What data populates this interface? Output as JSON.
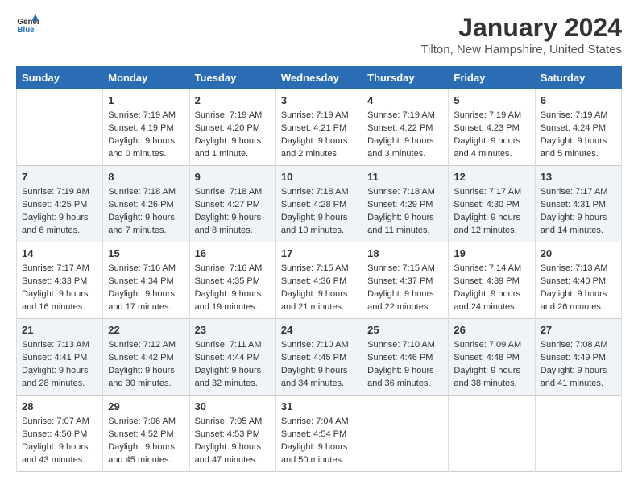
{
  "header": {
    "logo_line1": "General",
    "logo_line2": "Blue",
    "month_title": "January 2024",
    "location": "Tilton, New Hampshire, United States"
  },
  "days_of_week": [
    "Sunday",
    "Monday",
    "Tuesday",
    "Wednesday",
    "Thursday",
    "Friday",
    "Saturday"
  ],
  "weeks": [
    [
      {
        "num": "",
        "sunrise": "",
        "sunset": "",
        "daylight": ""
      },
      {
        "num": "1",
        "sunrise": "Sunrise: 7:19 AM",
        "sunset": "Sunset: 4:19 PM",
        "daylight": "Daylight: 9 hours and 0 minutes."
      },
      {
        "num": "2",
        "sunrise": "Sunrise: 7:19 AM",
        "sunset": "Sunset: 4:20 PM",
        "daylight": "Daylight: 9 hours and 1 minute."
      },
      {
        "num": "3",
        "sunrise": "Sunrise: 7:19 AM",
        "sunset": "Sunset: 4:21 PM",
        "daylight": "Daylight: 9 hours and 2 minutes."
      },
      {
        "num": "4",
        "sunrise": "Sunrise: 7:19 AM",
        "sunset": "Sunset: 4:22 PM",
        "daylight": "Daylight: 9 hours and 3 minutes."
      },
      {
        "num": "5",
        "sunrise": "Sunrise: 7:19 AM",
        "sunset": "Sunset: 4:23 PM",
        "daylight": "Daylight: 9 hours and 4 minutes."
      },
      {
        "num": "6",
        "sunrise": "Sunrise: 7:19 AM",
        "sunset": "Sunset: 4:24 PM",
        "daylight": "Daylight: 9 hours and 5 minutes."
      }
    ],
    [
      {
        "num": "7",
        "sunrise": "Sunrise: 7:19 AM",
        "sunset": "Sunset: 4:25 PM",
        "daylight": "Daylight: 9 hours and 6 minutes."
      },
      {
        "num": "8",
        "sunrise": "Sunrise: 7:18 AM",
        "sunset": "Sunset: 4:26 PM",
        "daylight": "Daylight: 9 hours and 7 minutes."
      },
      {
        "num": "9",
        "sunrise": "Sunrise: 7:18 AM",
        "sunset": "Sunset: 4:27 PM",
        "daylight": "Daylight: 9 hours and 8 minutes."
      },
      {
        "num": "10",
        "sunrise": "Sunrise: 7:18 AM",
        "sunset": "Sunset: 4:28 PM",
        "daylight": "Daylight: 9 hours and 10 minutes."
      },
      {
        "num": "11",
        "sunrise": "Sunrise: 7:18 AM",
        "sunset": "Sunset: 4:29 PM",
        "daylight": "Daylight: 9 hours and 11 minutes."
      },
      {
        "num": "12",
        "sunrise": "Sunrise: 7:17 AM",
        "sunset": "Sunset: 4:30 PM",
        "daylight": "Daylight: 9 hours and 12 minutes."
      },
      {
        "num": "13",
        "sunrise": "Sunrise: 7:17 AM",
        "sunset": "Sunset: 4:31 PM",
        "daylight": "Daylight: 9 hours and 14 minutes."
      }
    ],
    [
      {
        "num": "14",
        "sunrise": "Sunrise: 7:17 AM",
        "sunset": "Sunset: 4:33 PM",
        "daylight": "Daylight: 9 hours and 16 minutes."
      },
      {
        "num": "15",
        "sunrise": "Sunrise: 7:16 AM",
        "sunset": "Sunset: 4:34 PM",
        "daylight": "Daylight: 9 hours and 17 minutes."
      },
      {
        "num": "16",
        "sunrise": "Sunrise: 7:16 AM",
        "sunset": "Sunset: 4:35 PM",
        "daylight": "Daylight: 9 hours and 19 minutes."
      },
      {
        "num": "17",
        "sunrise": "Sunrise: 7:15 AM",
        "sunset": "Sunset: 4:36 PM",
        "daylight": "Daylight: 9 hours and 21 minutes."
      },
      {
        "num": "18",
        "sunrise": "Sunrise: 7:15 AM",
        "sunset": "Sunset: 4:37 PM",
        "daylight": "Daylight: 9 hours and 22 minutes."
      },
      {
        "num": "19",
        "sunrise": "Sunrise: 7:14 AM",
        "sunset": "Sunset: 4:39 PM",
        "daylight": "Daylight: 9 hours and 24 minutes."
      },
      {
        "num": "20",
        "sunrise": "Sunrise: 7:13 AM",
        "sunset": "Sunset: 4:40 PM",
        "daylight": "Daylight: 9 hours and 26 minutes."
      }
    ],
    [
      {
        "num": "21",
        "sunrise": "Sunrise: 7:13 AM",
        "sunset": "Sunset: 4:41 PM",
        "daylight": "Daylight: 9 hours and 28 minutes."
      },
      {
        "num": "22",
        "sunrise": "Sunrise: 7:12 AM",
        "sunset": "Sunset: 4:42 PM",
        "daylight": "Daylight: 9 hours and 30 minutes."
      },
      {
        "num": "23",
        "sunrise": "Sunrise: 7:11 AM",
        "sunset": "Sunset: 4:44 PM",
        "daylight": "Daylight: 9 hours and 32 minutes."
      },
      {
        "num": "24",
        "sunrise": "Sunrise: 7:10 AM",
        "sunset": "Sunset: 4:45 PM",
        "daylight": "Daylight: 9 hours and 34 minutes."
      },
      {
        "num": "25",
        "sunrise": "Sunrise: 7:10 AM",
        "sunset": "Sunset: 4:46 PM",
        "daylight": "Daylight: 9 hours and 36 minutes."
      },
      {
        "num": "26",
        "sunrise": "Sunrise: 7:09 AM",
        "sunset": "Sunset: 4:48 PM",
        "daylight": "Daylight: 9 hours and 38 minutes."
      },
      {
        "num": "27",
        "sunrise": "Sunrise: 7:08 AM",
        "sunset": "Sunset: 4:49 PM",
        "daylight": "Daylight: 9 hours and 41 minutes."
      }
    ],
    [
      {
        "num": "28",
        "sunrise": "Sunrise: 7:07 AM",
        "sunset": "Sunset: 4:50 PM",
        "daylight": "Daylight: 9 hours and 43 minutes."
      },
      {
        "num": "29",
        "sunrise": "Sunrise: 7:06 AM",
        "sunset": "Sunset: 4:52 PM",
        "daylight": "Daylight: 9 hours and 45 minutes."
      },
      {
        "num": "30",
        "sunrise": "Sunrise: 7:05 AM",
        "sunset": "Sunset: 4:53 PM",
        "daylight": "Daylight: 9 hours and 47 minutes."
      },
      {
        "num": "31",
        "sunrise": "Sunrise: 7:04 AM",
        "sunset": "Sunset: 4:54 PM",
        "daylight": "Daylight: 9 hours and 50 minutes."
      },
      {
        "num": "",
        "sunrise": "",
        "sunset": "",
        "daylight": ""
      },
      {
        "num": "",
        "sunrise": "",
        "sunset": "",
        "daylight": ""
      },
      {
        "num": "",
        "sunrise": "",
        "sunset": "",
        "daylight": ""
      }
    ]
  ]
}
